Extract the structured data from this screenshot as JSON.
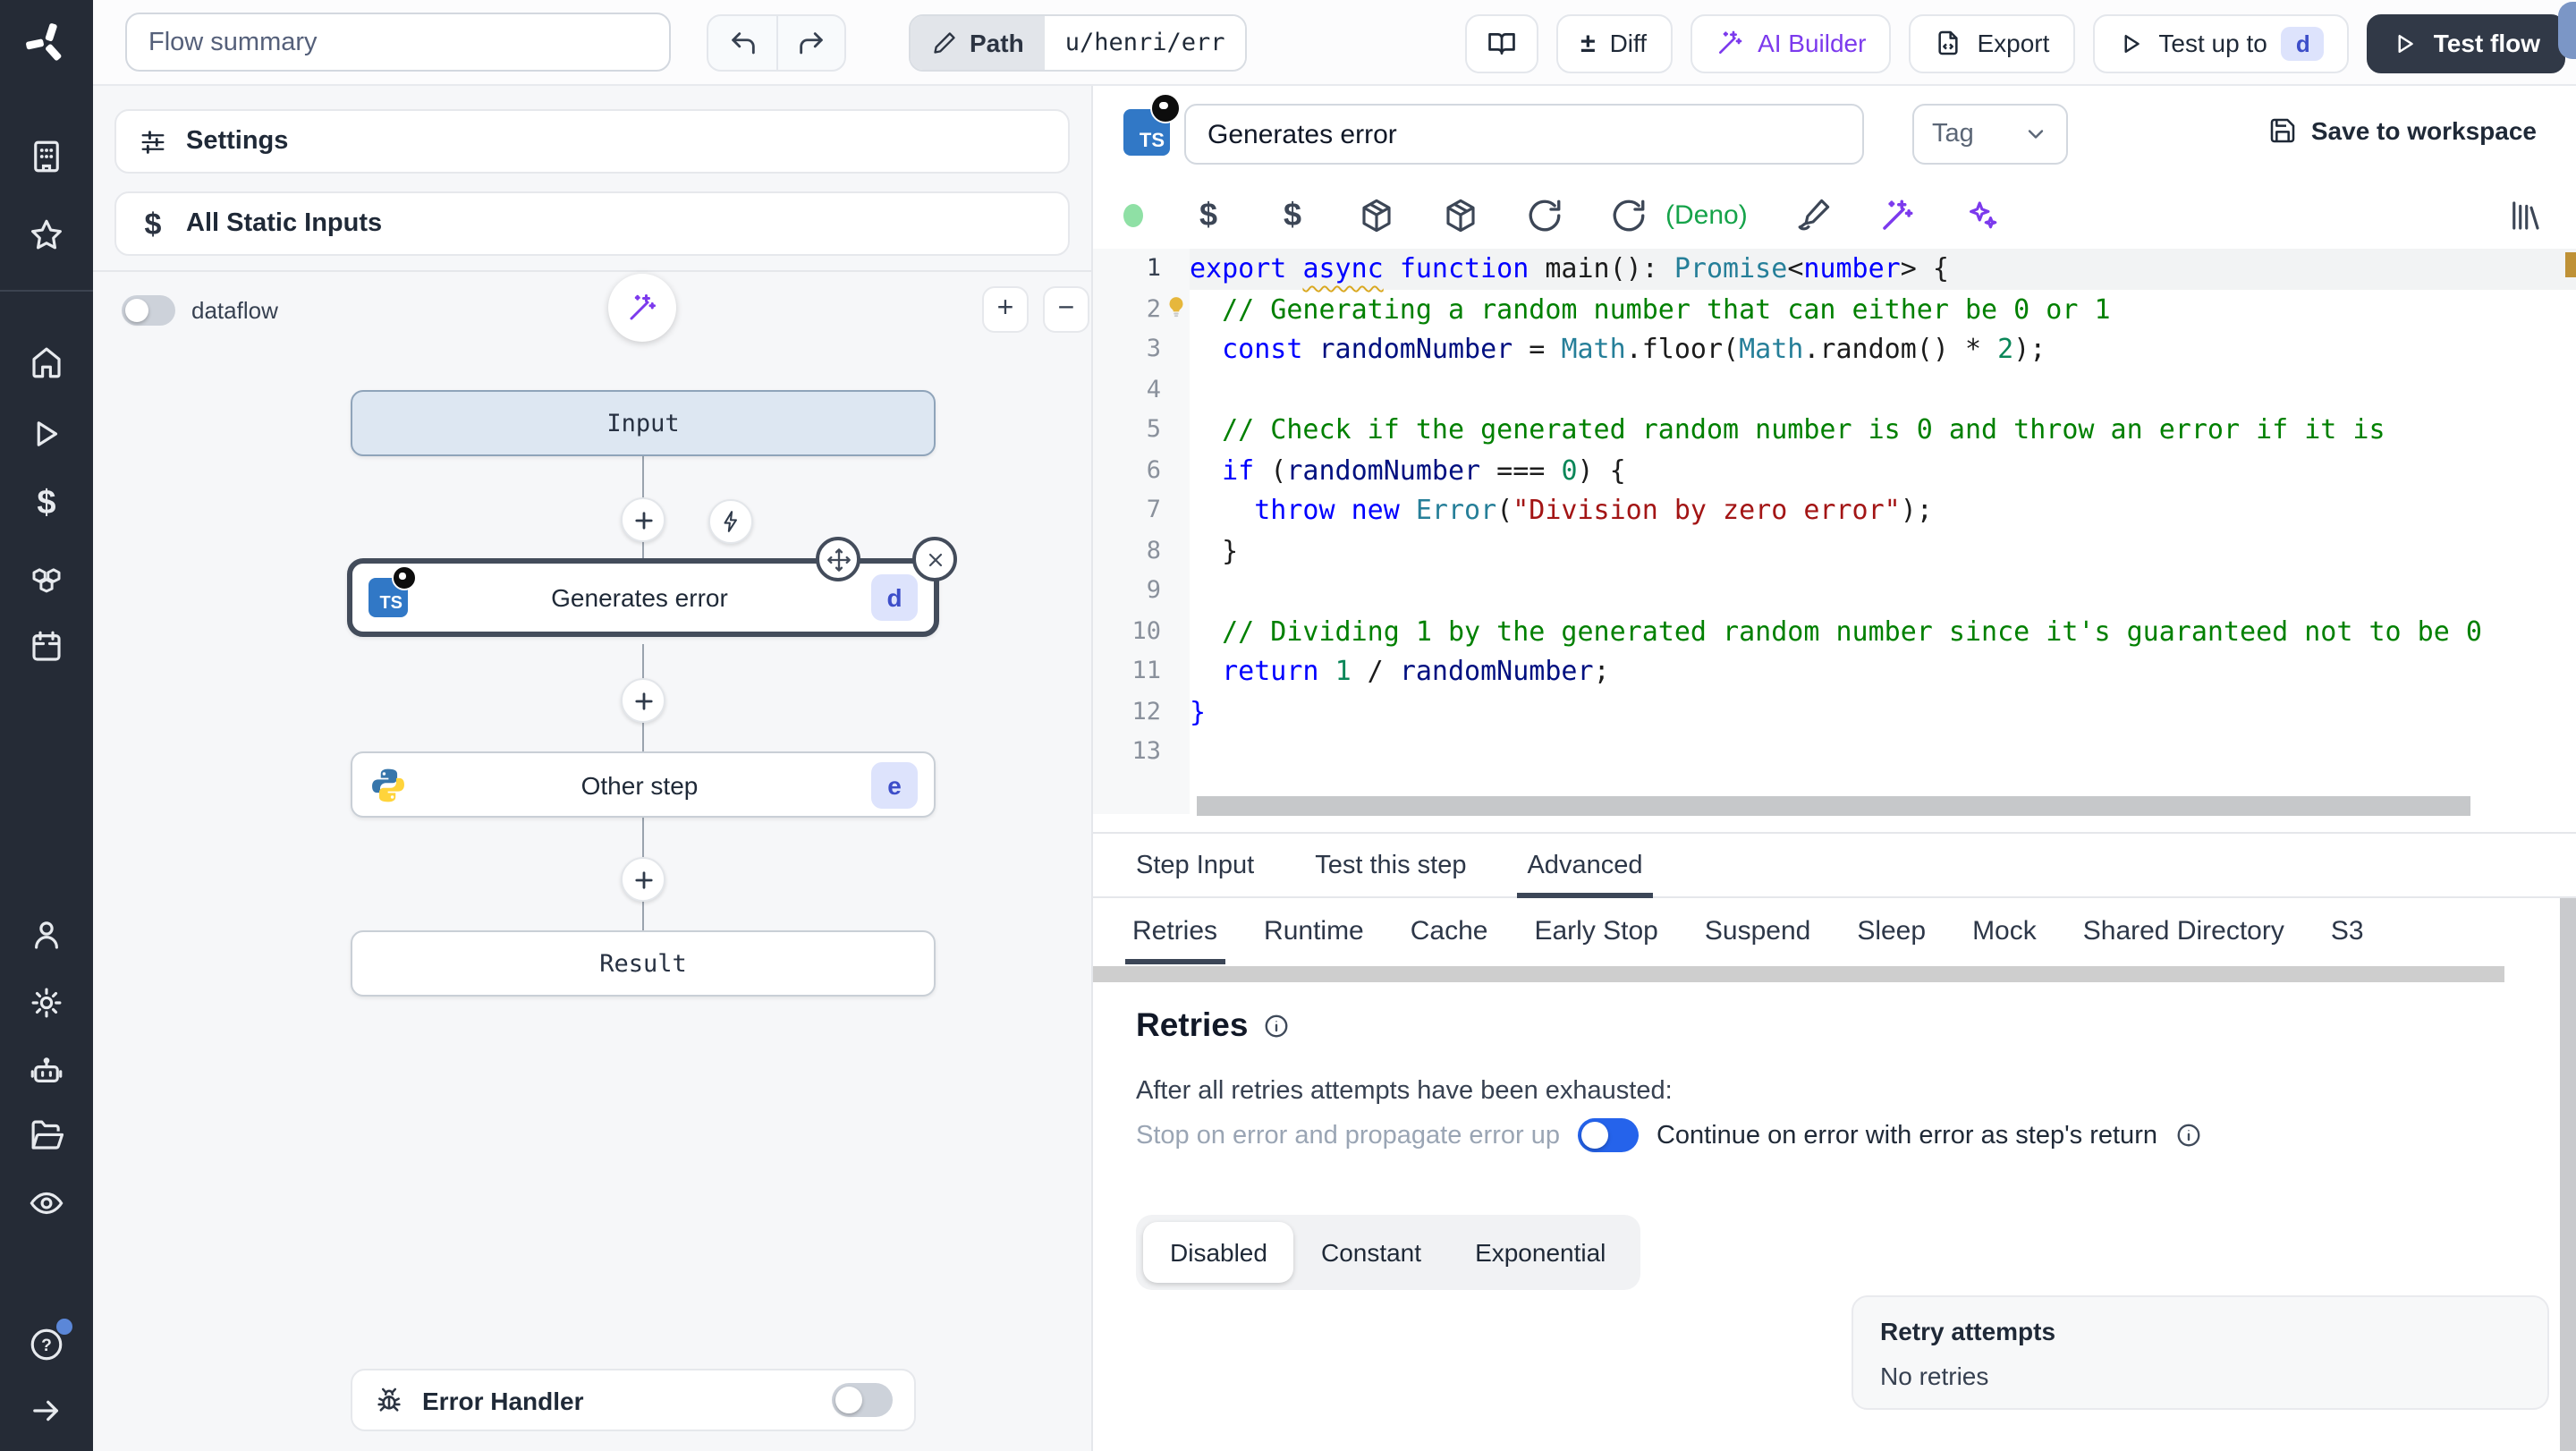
{
  "topbar": {
    "flow_summary_placeholder": "Flow summary",
    "path_label": "Path",
    "path_value": "u/henri/err",
    "diff_icon": "±",
    "buttons": {
      "diff": "Diff",
      "ai_builder": "AI Builder",
      "export": "Export",
      "test_up_to": "Test up to",
      "test_up_to_badge": "d",
      "test_flow": "Test flow"
    }
  },
  "left_panel": {
    "settings": "Settings",
    "all_static_inputs": "All Static Inputs",
    "static_inputs_icon": "$",
    "dataflow": "dataflow",
    "zoom_in": "+",
    "zoom_out": "−",
    "graph": {
      "input_node": "Input",
      "step_node": {
        "label": "Generates error",
        "badge": "d",
        "lang_badge": "TS"
      },
      "other_node": {
        "label": "Other step",
        "badge": "e"
      },
      "result_node": "Result"
    },
    "error_handler": "Error Handler"
  },
  "editor": {
    "step_name": "Generates error",
    "ts_badge": "TS",
    "tag_placeholder": "Tag",
    "save_to_workspace": "Save to workspace",
    "runtime_label": "(Deno)",
    "dollar_icon": "$",
    "tabs": [
      "Step Input",
      "Test this step",
      "Advanced"
    ],
    "active_tab": "Advanced",
    "subtabs": [
      "Retries",
      "Runtime",
      "Cache",
      "Early Stop",
      "Suspend",
      "Sleep",
      "Mock",
      "Shared Directory",
      "S3"
    ],
    "active_subtab": "Retries",
    "code": [
      [
        [
          "k",
          "export"
        ],
        [
          "pl",
          " "
        ],
        [
          "k2",
          "async"
        ],
        [
          "pl",
          " "
        ],
        [
          "k",
          "function"
        ],
        [
          "pl",
          " main(): "
        ],
        [
          "ty",
          "Promise"
        ],
        [
          "pl",
          "<"
        ],
        [
          "k",
          "number"
        ],
        [
          "pl",
          "> {"
        ]
      ],
      [
        [
          "pl",
          "  "
        ],
        [
          "cm",
          "// Generating a random number that can either be 0 or 1"
        ]
      ],
      [
        [
          "pl",
          "  "
        ],
        [
          "k",
          "const"
        ],
        [
          "pl",
          " "
        ],
        [
          "v",
          "randomNumber"
        ],
        [
          "pl",
          " = "
        ],
        [
          "ty",
          "Math"
        ],
        [
          "pl",
          ".floor("
        ],
        [
          "ty",
          "Math"
        ],
        [
          "pl",
          ".random() * "
        ],
        [
          "num",
          "2"
        ],
        [
          "pl",
          ");"
        ]
      ],
      [],
      [
        [
          "pl",
          "  "
        ],
        [
          "cm",
          "// Check if the generated random number is 0 and throw an error if it is"
        ]
      ],
      [
        [
          "pl",
          "  "
        ],
        [
          "k",
          "if"
        ],
        [
          "pl",
          " ("
        ],
        [
          "v",
          "randomNumber"
        ],
        [
          "pl",
          " === "
        ],
        [
          "num",
          "0"
        ],
        [
          "pl",
          ") {"
        ]
      ],
      [
        [
          "pl",
          "    "
        ],
        [
          "k",
          "throw"
        ],
        [
          "pl",
          " "
        ],
        [
          "k",
          "new"
        ],
        [
          "pl",
          " "
        ],
        [
          "ty",
          "Error"
        ],
        [
          "pl",
          "("
        ],
        [
          "s",
          "\"Division by zero error\""
        ],
        [
          "pl",
          ");"
        ]
      ],
      [
        [
          "pl",
          "  }"
        ]
      ],
      [],
      [
        [
          "pl",
          "  "
        ],
        [
          "cm",
          "// Dividing 1 by the generated random number since it's guaranteed not to be 0"
        ]
      ],
      [
        [
          "pl",
          "  "
        ],
        [
          "k",
          "return"
        ],
        [
          "pl",
          " "
        ],
        [
          "num",
          "1"
        ],
        [
          "pl",
          " / "
        ],
        [
          "v",
          "randomNumber"
        ],
        [
          "pl",
          ";"
        ]
      ],
      [
        [
          "k",
          "}"
        ]
      ],
      []
    ]
  },
  "retries": {
    "title": "Retries",
    "exhausted_label": "After all retries attempts have been exhausted:",
    "stop_option": "Stop on error and propagate error up",
    "continue_option": "Continue on error with error as step's return",
    "modes": [
      "Disabled",
      "Constant",
      "Exponential"
    ],
    "active_mode": "Disabled",
    "retry_attempts_label": "Retry attempts",
    "retry_attempts_value": "No retries"
  },
  "colors": {
    "accent_purple": "#7c3aed",
    "toggle_blue": "#2563eb",
    "deno_green": "#16a34a",
    "selection_dark": "#434c5b",
    "badge_bg": "#dde3fc",
    "badge_text": "#3d4ec9",
    "sidebar_bg": "#252b36"
  },
  "icons": {
    "sidebar": [
      "building",
      "star",
      "home",
      "play",
      "dollar",
      "boxes",
      "calendar",
      "user",
      "gear",
      "robot",
      "folder-open",
      "eye",
      "help-circle",
      "arrow-right"
    ],
    "topbar": [
      "undo",
      "redo",
      "pencil",
      "book-open",
      "plus-minus",
      "wand",
      "file-export",
      "play",
      "play"
    ],
    "editor_toolbar": [
      "status-dot",
      "dollar",
      "dollar",
      "package",
      "package",
      "refresh",
      "refresh",
      "paintbrush",
      "wand",
      "sparkles",
      "library"
    ]
  }
}
